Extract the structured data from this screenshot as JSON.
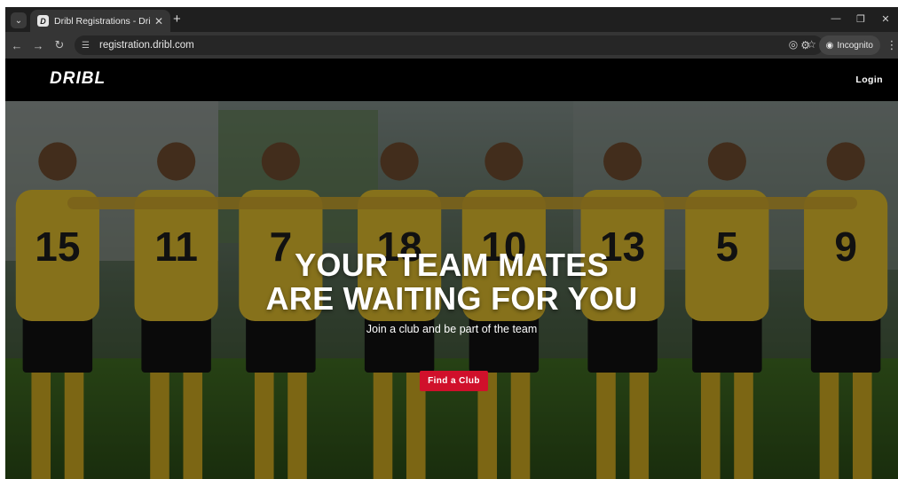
{
  "browser": {
    "tab_title": "Dribl Registrations - Dribl Regis",
    "favicon_letter": "D",
    "url": "registration.dribl.com",
    "incognito_label": "Incognito",
    "icons": [
      "tab-search-icon",
      "close-icon",
      "new-tab-icon",
      "back-icon",
      "forward-icon",
      "reload-icon",
      "site-info-icon",
      "eye-off-icon",
      "star-icon",
      "extensions-icon",
      "incognito-icon",
      "menu-icon"
    ]
  },
  "site": {
    "logo": "DRIBL",
    "login_label": "Login"
  },
  "hero": {
    "title_line1": "YOUR TEAM MATES",
    "title_line2": "ARE WAITING FOR YOU",
    "subtitle": "Join a club and be part of the team",
    "cta_label": "Find a Club",
    "accent_color": "#d0102b",
    "jersey_numbers": [
      "15",
      "11",
      "7",
      "18",
      "10",
      "13",
      "5",
      "9"
    ]
  }
}
